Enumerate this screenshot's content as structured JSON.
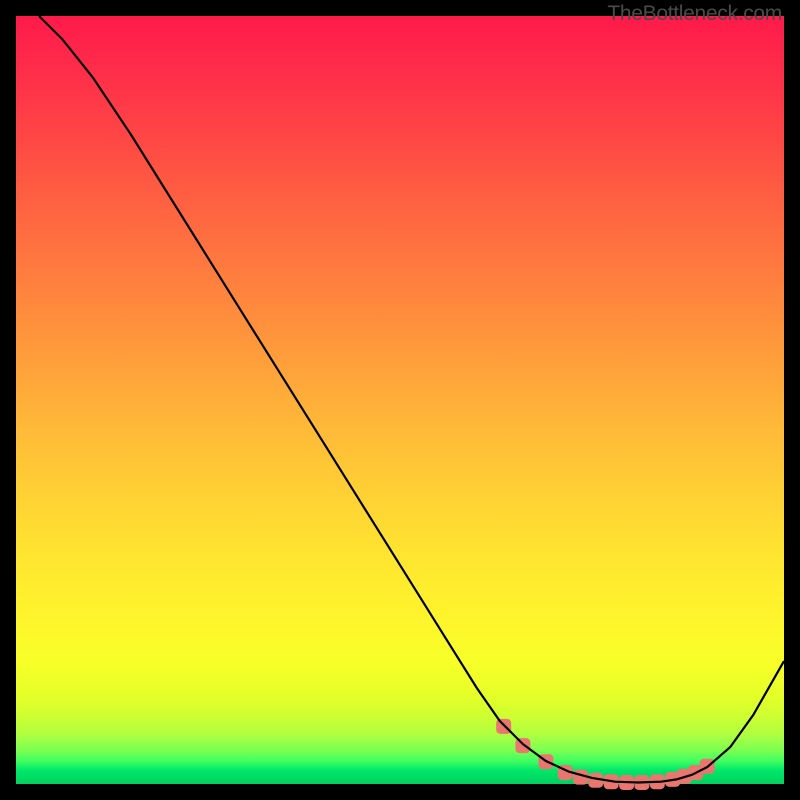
{
  "watermark": "TheBottleneck.com",
  "chart_data": {
    "type": "line",
    "title": "",
    "xlabel": "",
    "ylabel": "",
    "xlim": [
      0,
      100
    ],
    "ylim": [
      0,
      100
    ],
    "series": [
      {
        "name": "curve",
        "x": [
          3,
          6,
          10,
          15,
          20,
          25,
          30,
          35,
          40,
          45,
          50,
          55,
          60,
          63,
          66,
          69,
          72,
          75,
          78,
          81,
          84,
          86,
          88,
          90,
          93,
          96,
          100
        ],
        "y": [
          100,
          97,
          92,
          84.5,
          76.5,
          68.5,
          60.5,
          52.5,
          44.5,
          36.5,
          28.5,
          20.5,
          12.5,
          8.2,
          5.2,
          3.0,
          1.6,
          0.8,
          0.3,
          0.2,
          0.3,
          0.6,
          1.2,
          2.2,
          4.8,
          9.0,
          16.0
        ],
        "stroke": "#000000",
        "width": 2.2
      },
      {
        "name": "markers",
        "x": [
          63.5,
          66,
          69,
          71.5,
          73.5,
          75.5,
          77.5,
          79.5,
          81.5,
          83.5,
          85.5,
          87,
          88.5,
          90
        ],
        "y": [
          7.5,
          5.0,
          2.9,
          1.5,
          0.9,
          0.5,
          0.3,
          0.2,
          0.2,
          0.3,
          0.6,
          1.0,
          1.5,
          2.3
        ],
        "color": "#e9766f",
        "shape": "rounded-square",
        "size": 15
      }
    ]
  }
}
